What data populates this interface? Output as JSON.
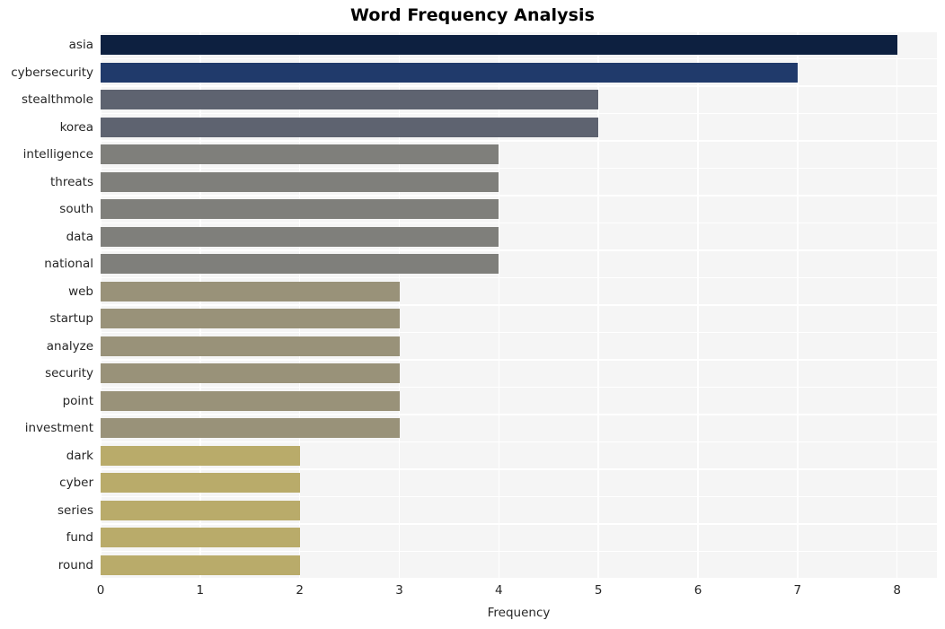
{
  "chart_data": {
    "type": "bar",
    "orientation": "horizontal",
    "title": "Word Frequency Analysis",
    "xlabel": "Frequency",
    "ylabel": "",
    "xlim": [
      0,
      8.4
    ],
    "xticks": [
      0,
      1,
      2,
      3,
      4,
      5,
      6,
      7,
      8
    ],
    "grid": true,
    "legend": null,
    "categories": [
      "asia",
      "cybersecurity",
      "stealthmole",
      "korea",
      "intelligence",
      "threats",
      "south",
      "data",
      "national",
      "web",
      "startup",
      "analyze",
      "security",
      "point",
      "investment",
      "dark",
      "cyber",
      "series",
      "fund",
      "round"
    ],
    "values": [
      8,
      7,
      5,
      5,
      4,
      4,
      4,
      4,
      4,
      3,
      3,
      3,
      3,
      3,
      3,
      2,
      2,
      2,
      2,
      2
    ],
    "bar_colors": [
      "#0d2040",
      "#203a6b",
      "#5e6370",
      "#5e6370",
      "#7f7f7b",
      "#7f7f7b",
      "#7f7f7b",
      "#7f7f7b",
      "#7f7f7b",
      "#999279",
      "#999279",
      "#999279",
      "#999279",
      "#999279",
      "#999279",
      "#b9ab6a",
      "#b9ab6a",
      "#b9ab6a",
      "#b9ab6a",
      "#b9ab6a"
    ],
    "plot_background": "#f5f5f5",
    "figure_background": "#ffffff",
    "gridline_color": "#ffffff",
    "text_color": "#262626"
  }
}
